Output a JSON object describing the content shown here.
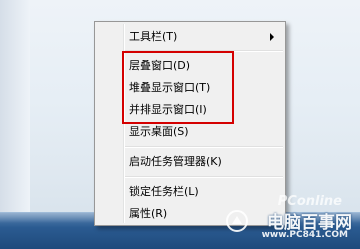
{
  "context_menu": {
    "toolbars_label": "工具栏(T)",
    "cascade_label": "层叠窗口(D)",
    "stacked_label": "堆叠显示窗口(T)",
    "side_by_side_label": "并排显示窗口(I)",
    "show_desktop_label": "显示桌面(S)",
    "task_manager_label": "启动任务管理器(K)",
    "lock_taskbar_label": "锁定任务栏(L)",
    "properties_label": "属性(R)"
  },
  "watermark": {
    "brand_top": "PConline",
    "brand_main": "电脑百事网",
    "url": "www.PC841.COM"
  },
  "colors": {
    "highlight_border": "#d40000",
    "taskbar": "#2b5b91"
  }
}
